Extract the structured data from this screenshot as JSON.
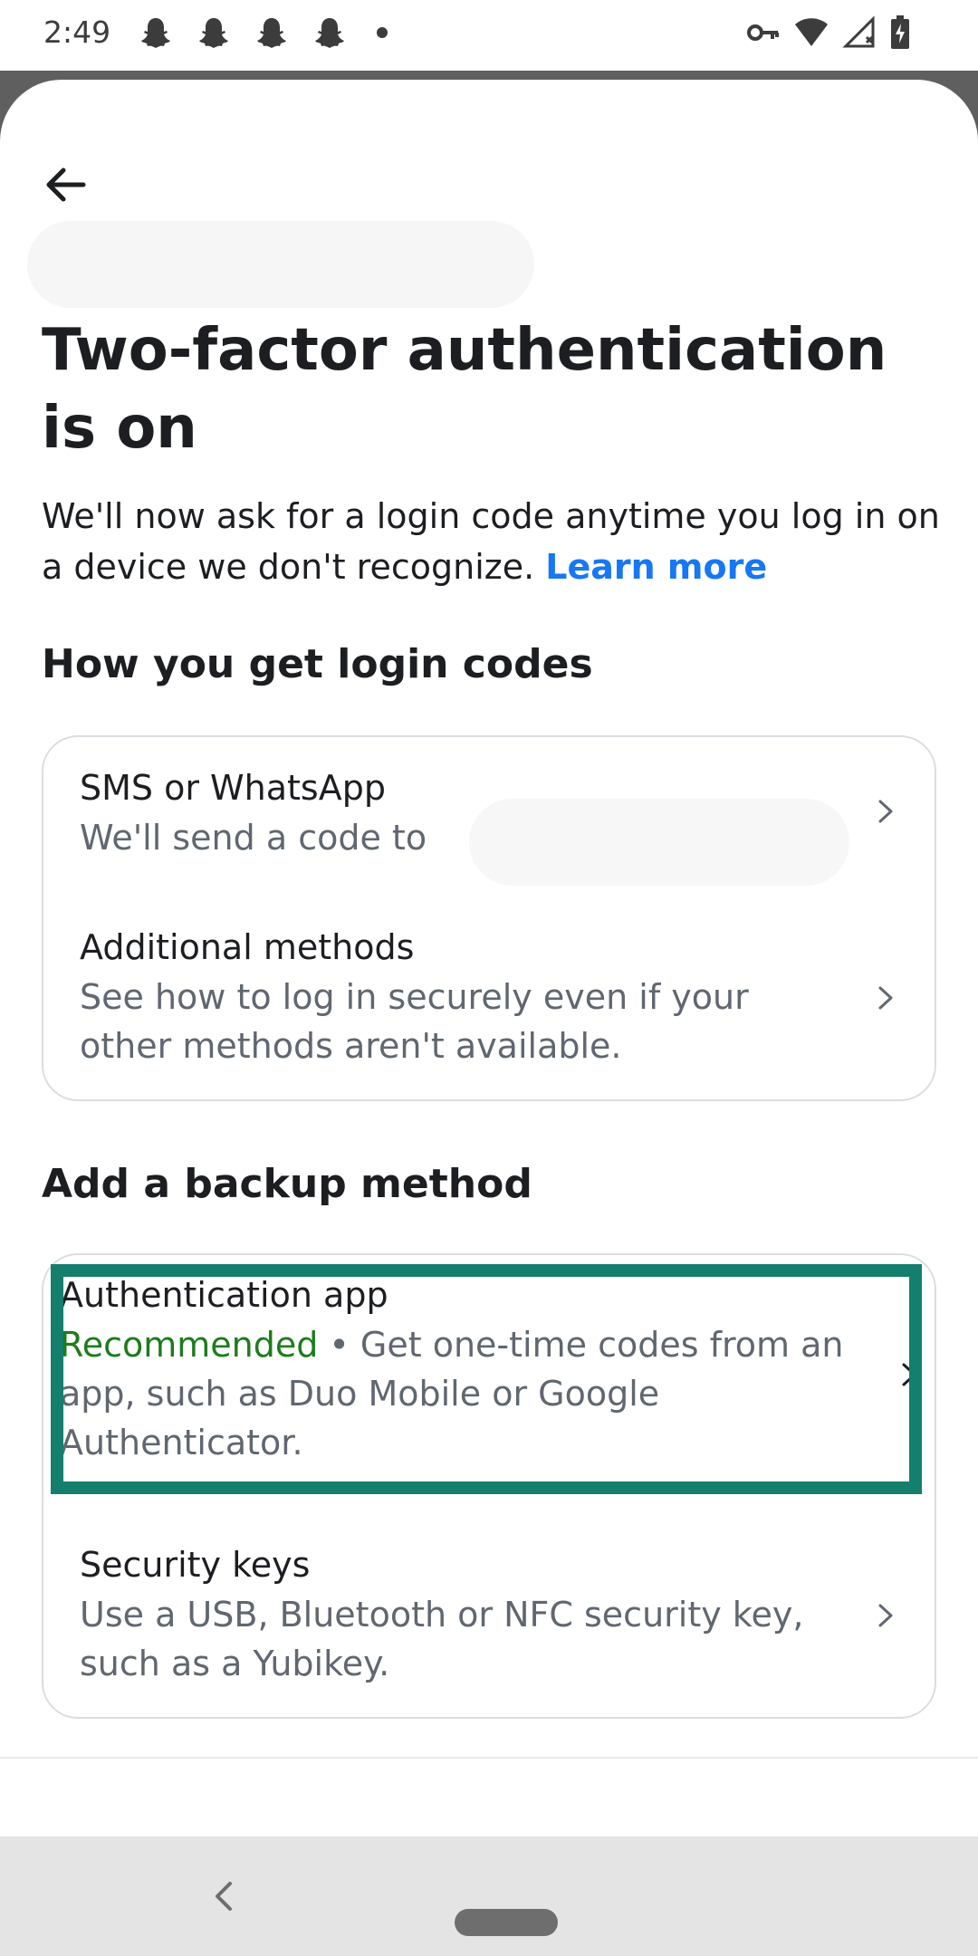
{
  "status_bar": {
    "time": "2:49",
    "notification_icons": [
      "snapchat-icon",
      "snapchat-icon",
      "snapchat-icon",
      "snapchat-icon"
    ],
    "right_icons": [
      "vpn-key-icon",
      "wifi-icon",
      "cellular-signal-icon",
      "battery-charging-icon"
    ]
  },
  "header": {
    "back_icon": "arrow-left-icon"
  },
  "page": {
    "title": "Two-factor authentication is on",
    "intro_text": "We'll now ask for a login code anytime you log in on a device we don't recognize.",
    "learn_more": "Learn more"
  },
  "login_codes": {
    "heading": "How you get login codes",
    "items": [
      {
        "title": "SMS or WhatsApp",
        "description": "We'll send a code to"
      },
      {
        "title": "Additional methods",
        "description": "See how to log in securely even if your other methods aren't available."
      }
    ]
  },
  "backup": {
    "heading": "Add a backup method",
    "items": [
      {
        "title": "Authentication app",
        "badge": "Recommended",
        "description": " • Get one-time codes from an app, such as Duo Mobile or Google Authenticator."
      },
      {
        "title": "Security keys",
        "description": "Use a USB, Bluetooth or NFC security key, such as a Yubikey."
      }
    ]
  },
  "colors": {
    "accent_link": "#1877f2",
    "recommended_green": "#1e7b1e",
    "highlight_box": "#147f6c"
  },
  "nav_bar": {
    "icons": [
      "nav-back-icon",
      "home-pill-icon"
    ]
  }
}
